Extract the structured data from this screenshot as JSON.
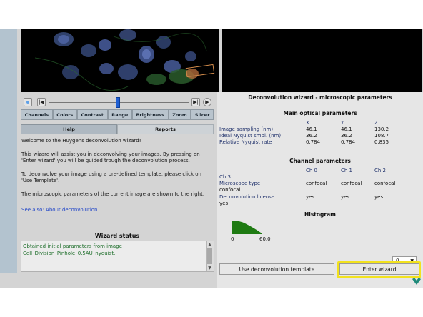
{
  "toolbar": {
    "tools": [
      "Channels",
      "Colors",
      "Contrast",
      "Range",
      "Brightness",
      "Zoom",
      "Slicer"
    ],
    "slider_position": 0.5
  },
  "tabs": [
    "Help",
    "Reports"
  ],
  "help": {
    "p1": "Welcome to the Huygens deconvolution wizard!",
    "p2": "This wizard will assist you in deconvolving your images. By pressing on 'Enter wizard' you will be guided trough the deconvolution process.",
    "p3": "To deconvolve your image using a pre-defined template, please click on 'Use Template'.",
    "p4": "The microscopic parameters of the current image are shown to the right.",
    "link": "See also: About deconvolution"
  },
  "wizard_status": {
    "title": "Wizard status",
    "line1": "Obtained initial parameters from image",
    "line2": "Cell_Division_Pinhole_0.5AU_nyquist."
  },
  "right": {
    "title": "Deconvolution wizard - microscopic parameters",
    "optical": {
      "title": "Main optical parameters",
      "cols": [
        "X",
        "Y",
        "Z"
      ],
      "rows": [
        {
          "label": "Image sampling (nm)",
          "x": "46.1",
          "y": "46.1",
          "z": "130.2"
        },
        {
          "label": "Ideal Nyquist smpl. (nm)",
          "x": "36.2",
          "y": "36.2",
          "z": "108.7"
        },
        {
          "label": "Relative Nyquist rate",
          "x": "0.784",
          "y": "0.784",
          "z": "0.835"
        }
      ]
    },
    "channel": {
      "title": "Channel parameters",
      "cols": [
        "Ch 0",
        "Ch 1",
        "Ch 2"
      ],
      "ch3": "Ch 3",
      "microscope_label": "Microscope type",
      "microscope_values": [
        "confocal",
        "confocal",
        "confocal"
      ],
      "microscope_extra": "confocal",
      "license_label": "Deconvolution license",
      "license_values": [
        "yes",
        "yes",
        "yes"
      ],
      "license_extra": "yes"
    },
    "histogram": {
      "title": "Histogram",
      "tick0": "0",
      "tick1": "60.0",
      "dropdown_value": "0"
    },
    "buttons": {
      "template": "Use deconvolution template",
      "enter": "Enter wizard"
    }
  },
  "colors": {
    "highlight": "#f2e21e",
    "link": "#2448c8",
    "status_text": "#1d6e2a",
    "histogram": "#1e7a12"
  }
}
